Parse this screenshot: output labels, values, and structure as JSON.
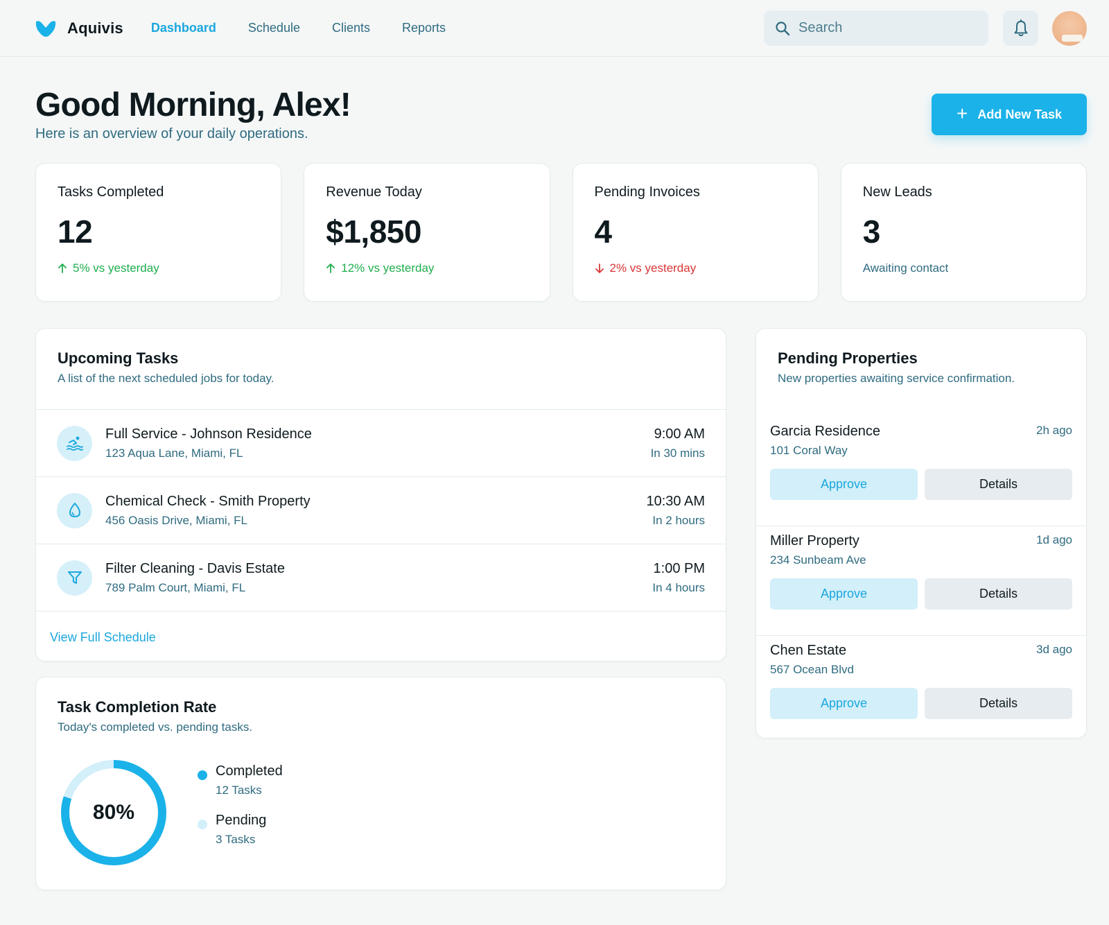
{
  "header": {
    "brand": "Aquivis",
    "nav": [
      {
        "label": "Dashboard",
        "active": true
      },
      {
        "label": "Schedule",
        "active": false
      },
      {
        "label": "Clients",
        "active": false
      },
      {
        "label": "Reports",
        "active": false
      }
    ],
    "search_placeholder": "Search"
  },
  "hero": {
    "greeting": "Good Morning, Alex!",
    "subtitle": "Here is an overview of your daily operations.",
    "add_button": "Add New Task"
  },
  "stats": [
    {
      "label": "Tasks Completed",
      "value": "12",
      "delta": "5% vs yesterday",
      "trend": "up"
    },
    {
      "label": "Revenue Today",
      "value": "$1,850",
      "delta": "12% vs yesterday",
      "trend": "up"
    },
    {
      "label": "Pending Invoices",
      "value": "4",
      "delta": "2% vs yesterday",
      "trend": "down"
    },
    {
      "label": "New Leads",
      "value": "3",
      "delta": "Awaiting contact",
      "trend": "neutral"
    }
  ],
  "upcoming": {
    "title": "Upcoming Tasks",
    "subtitle": "A list of the next scheduled jobs for today.",
    "tasks": [
      {
        "icon": "swimmer-icon",
        "name": "Full Service - Johnson Residence",
        "address": "123 Aqua Lane, Miami, FL",
        "time": "9:00 AM",
        "relative": "In 30 mins"
      },
      {
        "icon": "water-drop-icon",
        "name": "Chemical Check - Smith Property",
        "address": "456 Oasis Drive, Miami, FL",
        "time": "10:30 AM",
        "relative": "In 2 hours"
      },
      {
        "icon": "filter-icon",
        "name": "Filter Cleaning - Davis Estate",
        "address": "789 Palm Court, Miami, FL",
        "time": "1:00 PM",
        "relative": "In 4 hours"
      }
    ],
    "view_all": "View Full Schedule"
  },
  "pending": {
    "title": "Pending Properties",
    "subtitle": "New properties awaiting service confirmation.",
    "properties": [
      {
        "name": "Garcia Residence",
        "address": "101 Coral Way",
        "ago": "2h ago",
        "approve": "Approve",
        "details": "Details"
      },
      {
        "name": "Miller Property",
        "address": "234 Sunbeam Ave",
        "ago": "1d ago",
        "approve": "Approve",
        "details": "Details"
      },
      {
        "name": "Chen Estate",
        "address": "567 Ocean Blvd",
        "ago": "3d ago",
        "approve": "Approve",
        "details": "Details"
      }
    ]
  },
  "completion": {
    "title": "Task Completion Rate",
    "subtitle": "Today's completed vs. pending tasks.",
    "percent_label": "80%",
    "legend": [
      {
        "name": "Completed",
        "count": "12 Tasks"
      },
      {
        "name": "Pending",
        "count": "3 Tasks"
      }
    ]
  },
  "colors": {
    "accent": "#1ab2e8",
    "accent_light": "#d2effa",
    "up": "#1fae4d",
    "down": "#d93535",
    "muted": "#2f6b80"
  },
  "chart_data": {
    "type": "pie",
    "categories": [
      "Completed",
      "Pending"
    ],
    "values": [
      12,
      3
    ],
    "title": "Task Completion Rate",
    "center_label": "80%"
  }
}
